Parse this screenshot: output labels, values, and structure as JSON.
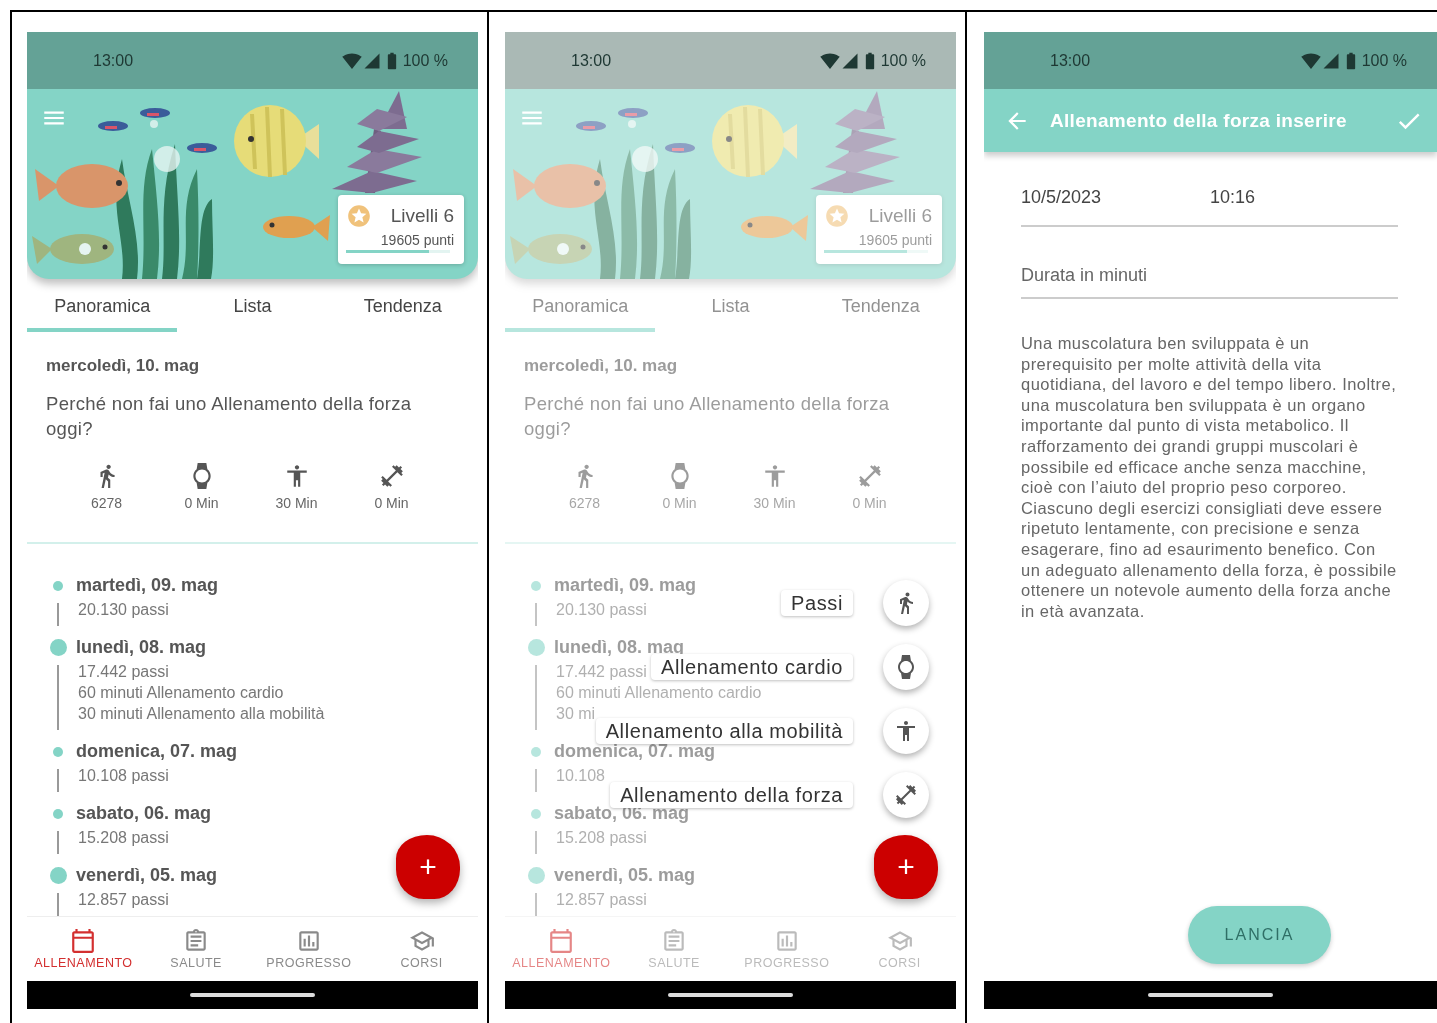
{
  "screens": [
    {
      "kind": "dashboard",
      "overlay": false,
      "status_bar": {
        "time": "13:00",
        "battery": "100 %"
      },
      "hero": {
        "title": "Livelli 6",
        "points": "19605 punti",
        "level": 0.8
      },
      "tabs": [
        {
          "label": "Panoramica",
          "selected": true
        },
        {
          "label": "Lista",
          "selected": false
        },
        {
          "label": "Tendenza",
          "selected": false
        }
      ],
      "today": {
        "date": "mercoledì, 10. mag",
        "prompt": "Perché non fai uno Allenamento della forza oggi?"
      },
      "stats": [
        {
          "kind": "steps",
          "value": "6278"
        },
        {
          "kind": "cardio",
          "value": "0 Min"
        },
        {
          "kind": "mobility",
          "value": "30 Min"
        },
        {
          "kind": "strength",
          "value": "0 Min"
        }
      ],
      "timeline": [
        {
          "date": "martedì, 09. mag",
          "highlighted": false,
          "lines": [
            "20.130 passi"
          ]
        },
        {
          "date": "lunedì, 08. mag",
          "highlighted": true,
          "lines": [
            "17.442 passi",
            "60 minuti Allenamento cardio",
            "30 minuti Allenamento alla mobilità"
          ]
        },
        {
          "date": "domenica, 07. mag",
          "highlighted": false,
          "lines": [
            "10.108 passi"
          ]
        },
        {
          "date": "sabato, 06. mag",
          "highlighted": false,
          "lines": [
            "15.208 passi"
          ]
        },
        {
          "date": "venerdì, 05. mag",
          "highlighted": true,
          "lines": [
            "12.857 passi"
          ]
        }
      ],
      "fab": "+",
      "nav": [
        {
          "label": "ALLENAMENTO",
          "selected": true
        },
        {
          "label": "SALUTE",
          "selected": false
        },
        {
          "label": "PROGRESSO",
          "selected": false
        },
        {
          "label": "CORSI",
          "selected": false
        }
      ]
    },
    {
      "kind": "dashboard",
      "overlay": true,
      "status_bar": {
        "time": "13:00",
        "battery": "100 %"
      },
      "hero": {
        "title": "Livelli 6",
        "points": "19605 punti",
        "level": 0.8
      },
      "tabs": [
        {
          "label": "Panoramica",
          "selected": true
        },
        {
          "label": "Lista",
          "selected": false
        },
        {
          "label": "Tendenza",
          "selected": false
        }
      ],
      "today": {
        "date": "mercoledì, 10. mag",
        "prompt": "Perché non fai uno Allenamento della forza oggi?"
      },
      "stats": [
        {
          "kind": "steps",
          "value": "6278"
        },
        {
          "kind": "cardio",
          "value": "0 Min"
        },
        {
          "kind": "mobility",
          "value": "30 Min"
        },
        {
          "kind": "strength",
          "value": "0 Min"
        }
      ],
      "timeline": [
        {
          "date": "martedì, 09. mag",
          "highlighted": false,
          "lines": [
            "20.130 passi"
          ]
        },
        {
          "date": "lunedì, 08. mag",
          "highlighted": true,
          "lines": [
            "17.442 passi",
            "60 minuti Allenamento cardio",
            "30 mi"
          ]
        },
        {
          "date": "domenica, 07. mag",
          "highlighted": false,
          "lines": [
            "10.108"
          ]
        },
        {
          "date": "sabato, 06. mag",
          "highlighted": false,
          "lines": [
            "15.208 passi"
          ]
        },
        {
          "date": "venerdì, 05. mag",
          "highlighted": true,
          "lines": [
            "12.857 passi"
          ]
        }
      ],
      "fab": "+",
      "speed_dial": [
        {
          "kind": "steps",
          "label": "Passi"
        },
        {
          "kind": "cardio",
          "label": "Allenamento cardio"
        },
        {
          "kind": "mobility",
          "label": "Allenamento alla mobilità"
        },
        {
          "kind": "strength",
          "label": "Allenamento della forza"
        }
      ],
      "nav": [
        {
          "label": "ALLENAMENTO",
          "selected": true
        },
        {
          "label": "SALUTE",
          "selected": false
        },
        {
          "label": "PROGRESSO",
          "selected": false
        },
        {
          "label": "CORSI",
          "selected": false
        }
      ]
    },
    {
      "kind": "form",
      "status_bar": {
        "time": "13:00",
        "battery": "100 %"
      },
      "title": "Allenamento della forza inserire",
      "date": "10/5/2023",
      "time": "10:16",
      "duration_placeholder": "Durata in minuti",
      "description": "Una muscolatura ben sviluppata è un prerequisito per molte attività della vita quotidiana, del lavoro e del tempo libero. Inoltre, una muscolatura ben sviluppata è un organo importante dal punto di vista metabolico. Il rafforzamento dei grandi gruppi muscolari è possibile ed efficace anche senza macchine, cioè con l’aiuto del proprio peso corporeo. Ciascuno degli esercizi consigliati deve essere ripetuto lentamente, con precisione e senza esagerare, fino ad esaurimento benefico. Con un adeguato allenamento della forza, è possibile ottenere un notevole aumento della forza anche in età avanzata.",
      "button": "LANCIA"
    }
  ]
}
